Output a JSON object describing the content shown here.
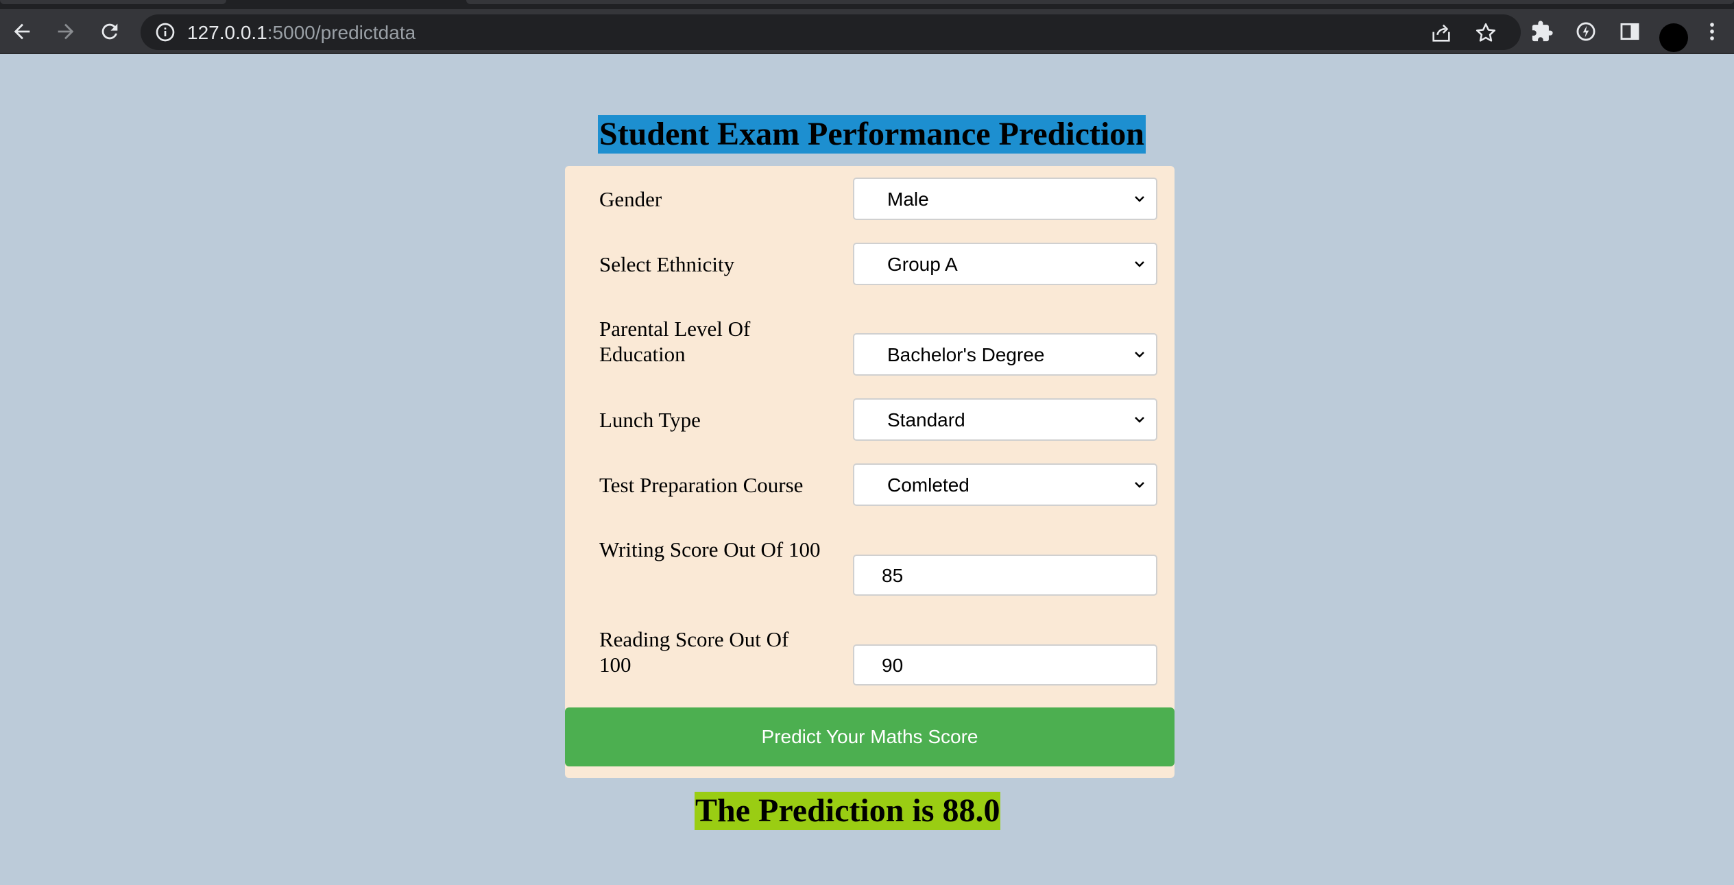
{
  "browser": {
    "url_host": "127.0.0.1",
    "url_path": ":5000/predictdata"
  },
  "page": {
    "title": "Student Exam Performance Prediction",
    "fields": [
      {
        "label": "Gender",
        "value": "Male"
      },
      {
        "label": "Select Ethnicity",
        "value": "Group A"
      },
      {
        "label": "Parental Level Of Education",
        "value": "Bachelor's Degree"
      },
      {
        "label": "Lunch Type",
        "value": "Standard"
      },
      {
        "label": "Test Preparation Course",
        "value": "Comleted"
      },
      {
        "label": "Writing Score Out Of 100",
        "value": "85"
      },
      {
        "label": "Reading Score Out Of 100",
        "value": "90"
      }
    ],
    "submit_label": "Predict Your Maths Score",
    "result_text": "The Prediction is 88.0"
  },
  "colors": {
    "background": "#bccbd9",
    "title_highlight": "#1d8fd0",
    "card": "#fae9d6",
    "button": "#4caf50",
    "result_highlight": "#9acd13"
  },
  "icons": [
    "back-arrow-icon",
    "forward-arrow-icon",
    "reload-icon",
    "info-icon",
    "share-icon",
    "star-icon",
    "extensions-icon",
    "performance-icon",
    "side-panel-icon",
    "avatar",
    "menu-dots-icon",
    "chevron-down-icon"
  ]
}
